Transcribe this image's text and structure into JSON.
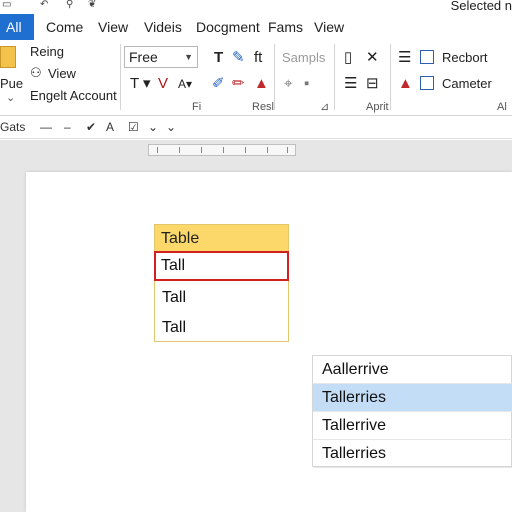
{
  "status_text": "Selected n",
  "tabs": [
    "All",
    "Come",
    "View",
    "Videis",
    "Docgment",
    "Fams",
    "View"
  ],
  "ribbon": {
    "clipboard": {
      "paste_label": "Pue",
      "items": [
        "Reing",
        "View",
        "Engelt Account"
      ]
    },
    "font": {
      "font_name": "Free",
      "group_label": "Fi"
    },
    "styles": {
      "placeholder": "Sampls",
      "group_label": "Resl"
    },
    "editing": {
      "group_label": "Aprit"
    },
    "report": {
      "items": [
        "Recbort",
        "Cameter"
      ],
      "group_label": "Al"
    }
  },
  "qbar": {
    "label": "Gats"
  },
  "table": {
    "header": "Table",
    "rows": [
      "Tall",
      "Tall",
      "Tall"
    ],
    "selected_row": 0
  },
  "autocomplete": {
    "items": [
      "Aallerrive",
      "Tallerries",
      "Tallerrive",
      "Tallerries"
    ],
    "highlighted": 1
  },
  "colors": {
    "accent": "#1e6fd0",
    "table_header": "#fcd76a",
    "selection_border": "#d21f1f",
    "highlight": "#c3ddf6"
  }
}
